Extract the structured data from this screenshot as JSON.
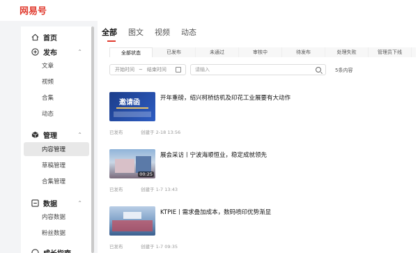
{
  "brand": {
    "logo_text": "网易号"
  },
  "sidebar": {
    "home": "首页",
    "publish": {
      "label": "发布",
      "items": [
        "文章",
        "视频",
        "合集",
        "动态"
      ]
    },
    "manage": {
      "label": "管理",
      "items": [
        "内容管理",
        "草稿管理",
        "合集管理"
      ]
    },
    "data": {
      "label": "数据",
      "items": [
        "内容数据",
        "粉丝数据"
      ]
    },
    "growth": {
      "label": "成长指南"
    }
  },
  "main": {
    "tabs": [
      "全部",
      "图文",
      "视频",
      "动态"
    ],
    "filters": [
      "全部状态",
      "已发布",
      "未通过",
      "审核中",
      "待发布",
      "处理失败",
      "管理员下线"
    ],
    "date_start_placeholder": "开始时间",
    "date_sep": "~",
    "date_end_placeholder": "结束时间",
    "search_placeholder": "请输入",
    "count_text": "5条内容",
    "items": [
      {
        "title": "开年重磅，绍兴柯桥纺机及印花工业展要有大动作",
        "status": "已发布",
        "created": "创建于 2-18 13:56",
        "thumb_text": "邀请函"
      },
      {
        "title": "展会采访丨宁波海顺恒业，稳定成就领先",
        "status": "已发布",
        "created": "创建于 1-7 13:43",
        "duration": "00:25"
      },
      {
        "title": "KTPIE丨需求叠加成本，数码喷印优势渐显",
        "status": "已发布",
        "created": "创建于 1-7 09:35"
      }
    ]
  }
}
